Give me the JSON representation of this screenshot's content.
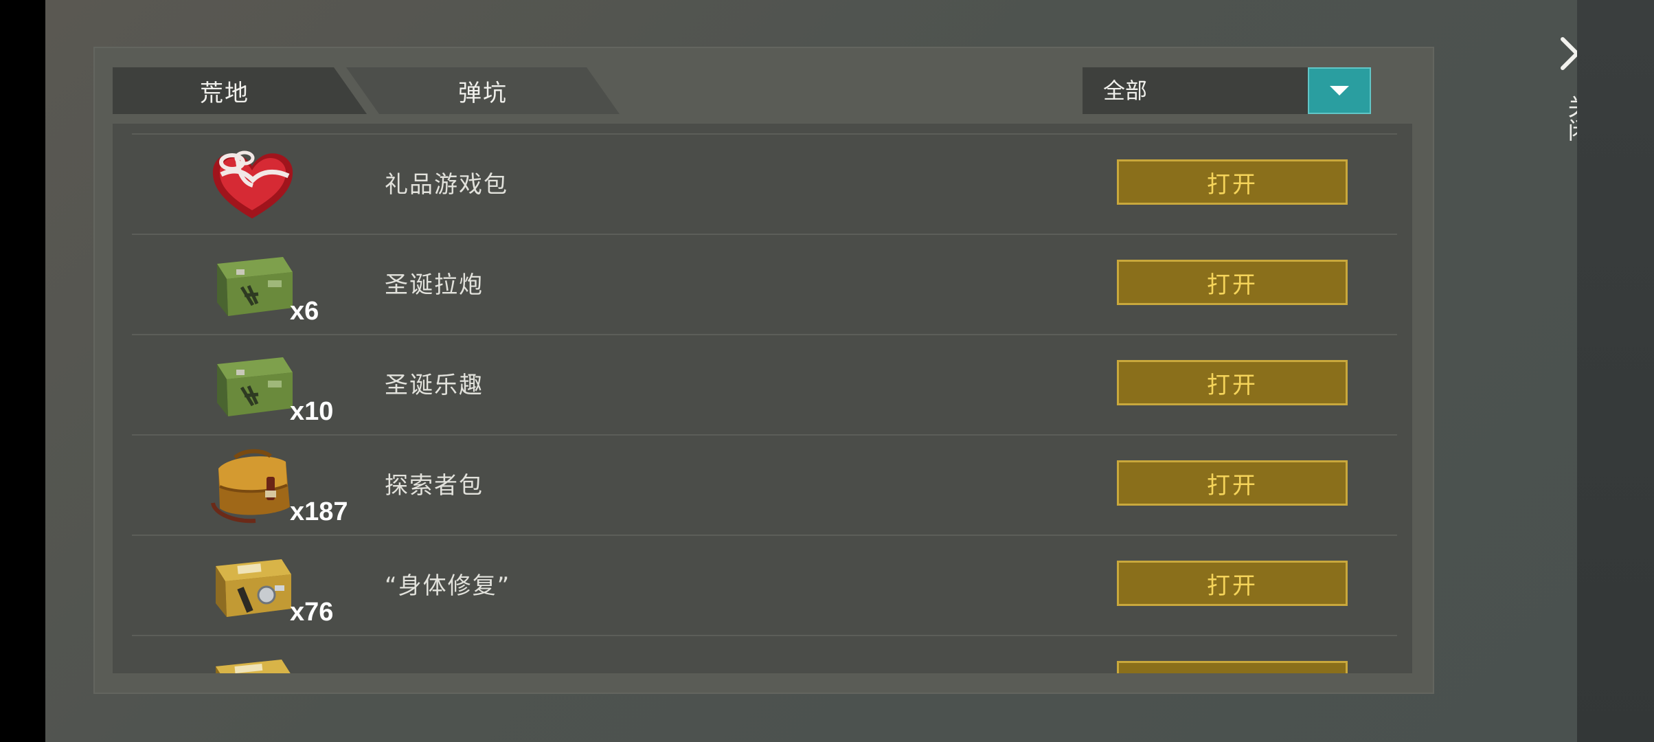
{
  "tabs": [
    {
      "label": "荒地"
    },
    {
      "label": "弹坑"
    }
  ],
  "filter": {
    "selected": "全部"
  },
  "close": {
    "label": "关闭"
  },
  "items": [
    {
      "name": "礼品游戏包",
      "count": "",
      "icon": "heart-gift-box-icon",
      "button": "打开"
    },
    {
      "name": "圣诞拉炮",
      "count": "x6",
      "icon": "green-military-crate-icon",
      "button": "打开"
    },
    {
      "name": "圣诞乐趣",
      "count": "x10",
      "icon": "green-military-crate-icon",
      "button": "打开"
    },
    {
      "name": "探索者包",
      "count": "x187",
      "icon": "explorer-bag-icon",
      "button": "打开"
    },
    {
      "name": "“身体修复”",
      "count": "x76",
      "icon": "medical-crate-icon",
      "button": "打开"
    },
    {
      "name": "",
      "count": "",
      "icon": "blueprint-box-icon",
      "button": ""
    }
  ],
  "colors": {
    "accent": "#2a9ea0",
    "button_fill": "#8a6f1b",
    "button_border": "#c9a83c",
    "button_text": "#f5d45a"
  }
}
